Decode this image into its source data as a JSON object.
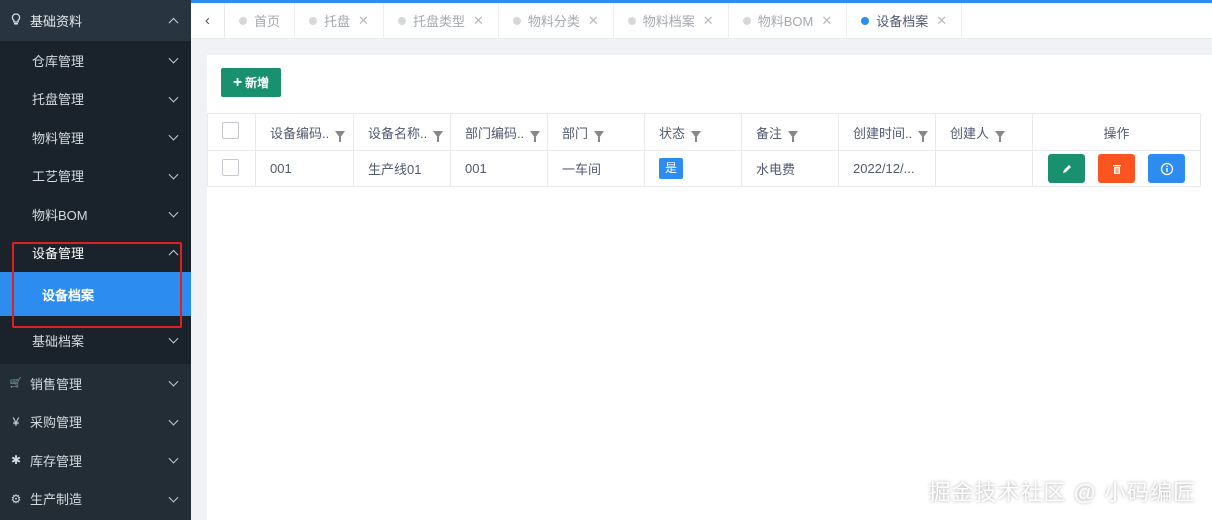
{
  "sidebar": {
    "groups_top": {
      "label": "基础资料",
      "icon": "bulb-icon"
    },
    "sub_items": [
      {
        "label": "仓库管理"
      },
      {
        "label": "托盘管理"
      },
      {
        "label": "物料管理"
      },
      {
        "label": "工艺管理"
      },
      {
        "label": "物料BOM"
      },
      {
        "label": "设备管理"
      }
    ],
    "active_leaf": {
      "label": "设备档案"
    },
    "after_items": [
      {
        "label": "基础档案"
      }
    ],
    "groups_bottom": [
      {
        "label": "销售管理",
        "icon": "cart-icon",
        "glyph": "🛒"
      },
      {
        "label": "采购管理",
        "icon": "yen-icon",
        "glyph": "¥"
      },
      {
        "label": "库存管理",
        "icon": "asterisk-icon",
        "glyph": "✱"
      },
      {
        "label": "生产制造",
        "icon": "gear-icon",
        "glyph": "⚙"
      }
    ]
  },
  "tabs": [
    {
      "label": "首页",
      "closable": false,
      "active": false
    },
    {
      "label": "托盘",
      "closable": true,
      "active": false
    },
    {
      "label": "托盘类型",
      "closable": true,
      "active": false
    },
    {
      "label": "物料分类",
      "closable": true,
      "active": false
    },
    {
      "label": "物料档案",
      "closable": true,
      "active": false
    },
    {
      "label": "物料BOM",
      "closable": true,
      "active": false
    },
    {
      "label": "设备档案",
      "closable": true,
      "active": true
    }
  ],
  "toolbar": {
    "add_label": "新增"
  },
  "table": {
    "columns": [
      "设备编码..",
      "设备名称..",
      "部门编码..",
      "部门",
      "状态",
      "备注",
      "创建时间..",
      "创建人",
      "操作"
    ],
    "rows": [
      {
        "code": "001",
        "name": "生产线01",
        "dept_code": "001",
        "dept": "一车间",
        "status": "是",
        "remark": "水电费",
        "created": "2022/12/...",
        "creator": ""
      }
    ]
  },
  "colors": {
    "primary": "#2d8cf0",
    "sidebar": "#222d36",
    "green": "#19916f",
    "orange": "#fc5420",
    "highlight": "#e02020"
  },
  "watermark": "掘金技术社区 @ 小码编匠"
}
